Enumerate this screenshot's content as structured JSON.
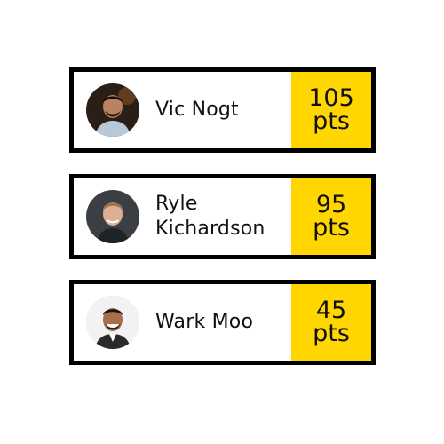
{
  "colors": {
    "card_border": "#000000",
    "score_background": "#ffd600",
    "text": "#111111"
  },
  "players": [
    {
      "name": "Vic Nogt",
      "points": "105",
      "unit": "pts",
      "avatar_icon": "person-avatar-icon"
    },
    {
      "name": "Ryle Kichardson",
      "points": "95",
      "unit": "pts",
      "avatar_icon": "person-avatar-icon"
    },
    {
      "name": "Wark Moo",
      "points": "45",
      "unit": "pts",
      "avatar_icon": "person-avatar-icon"
    }
  ]
}
